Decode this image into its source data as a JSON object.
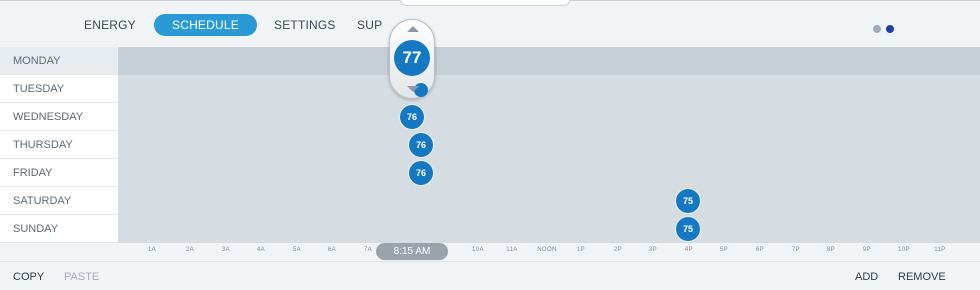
{
  "nav": {
    "tabs": [
      {
        "label": "ENERGY",
        "active": false
      },
      {
        "label": "SCHEDULE",
        "active": true
      },
      {
        "label": "SETTINGS",
        "active": false
      },
      {
        "label": "SUP",
        "active": false
      }
    ],
    "page_dots": {
      "count": 2,
      "active_index": 1,
      "colors": {
        "inactive": "#a3acb4",
        "active": "#1f3fa8"
      }
    }
  },
  "schedule": {
    "days": [
      "MONDAY",
      "TUESDAY",
      "WEDNESDAY",
      "THURSDAY",
      "FRIDAY",
      "SATURDAY",
      "SUNDAY"
    ],
    "selected_day": "MONDAY",
    "setpoints": [
      {
        "day": "TUESDAY",
        "temp": "",
        "time": "8:15 AM"
      },
      {
        "day": "WEDNESDAY",
        "temp": "76",
        "time": "8:00 AM"
      },
      {
        "day": "THURSDAY",
        "temp": "76",
        "time": "8:15 AM"
      },
      {
        "day": "FRIDAY",
        "temp": "76",
        "time": "8:15 AM"
      },
      {
        "day": "SATURDAY",
        "temp": "75",
        "time": "4:00 PM"
      },
      {
        "day": "SUNDAY",
        "temp": "75",
        "time": "4:00 PM"
      }
    ]
  },
  "popup": {
    "temp": "77"
  },
  "timeline": {
    "ticks": [
      "1A",
      "2A",
      "3A",
      "4A",
      "5A",
      "6A",
      "7A",
      "10A",
      "11A",
      "NOON",
      "1P",
      "2P",
      "3P",
      "4P",
      "5P",
      "6P",
      "7P",
      "8P",
      "9P",
      "10P",
      "11P"
    ],
    "current_time": "8:15 AM"
  },
  "bottom": {
    "copy_label": "COPY",
    "paste_label": "PASTE",
    "add_label": "ADD",
    "remove_label": "REMOVE"
  },
  "colors": {
    "accent": "#2a9ad6",
    "setpoint": "#1479c2"
  }
}
